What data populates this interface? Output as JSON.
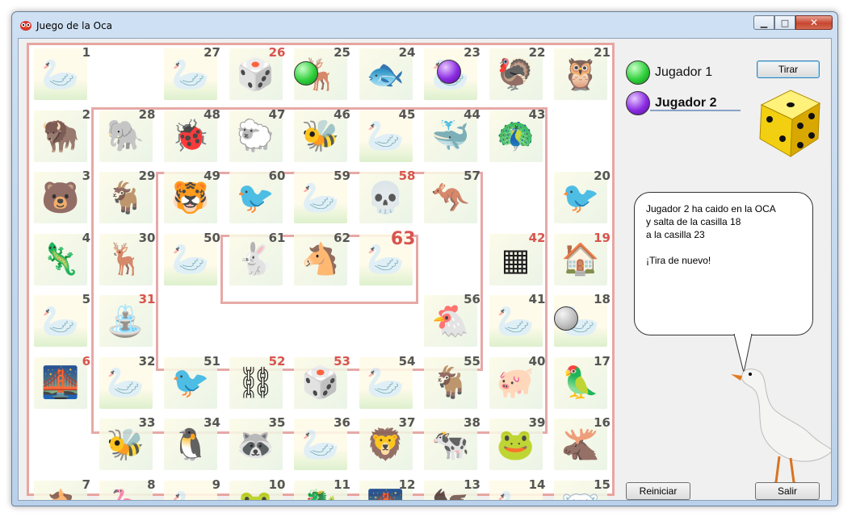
{
  "window": {
    "title": "Juego de la Oca"
  },
  "players": [
    {
      "name": "Jugador 1",
      "color": "#2fcf3a",
      "active": false
    },
    {
      "name": "Jugador 2",
      "color": "#8a2be2",
      "active": true
    }
  ],
  "buttons": {
    "roll": "Tirar",
    "restart": "Reiniciar",
    "exit": "Salir"
  },
  "message": [
    "Jugador 2 ha caido en la OCA",
    "y salta de la casilla 18",
    "a la casilla 23",
    "",
    "¡Tira de nuevo!"
  ],
  "board": {
    "cells": [
      {
        "n": "1",
        "icon": "goose",
        "red": false
      },
      {
        "n": "2",
        "icon": "bison",
        "red": false
      },
      {
        "n": "3",
        "icon": "bear",
        "red": false
      },
      {
        "n": "4",
        "icon": "chameleon",
        "red": false
      },
      {
        "n": "5",
        "icon": "goose",
        "red": false
      },
      {
        "n": "6",
        "icon": "bridge",
        "red": true
      },
      {
        "n": "7",
        "icon": "horse",
        "red": false
      },
      {
        "n": "8",
        "icon": "flamingo",
        "red": false
      },
      {
        "n": "9",
        "icon": "goose",
        "red": false
      },
      {
        "n": "10",
        "icon": "frog",
        "red": false
      },
      {
        "n": "11",
        "icon": "seahorse",
        "red": false
      },
      {
        "n": "12",
        "icon": "bridge",
        "red": false
      },
      {
        "n": "13",
        "icon": "eagle",
        "red": false
      },
      {
        "n": "14",
        "icon": "goose",
        "red": false
      },
      {
        "n": "15",
        "icon": "polar-bear",
        "red": false
      },
      {
        "n": "16",
        "icon": "moose",
        "red": false
      },
      {
        "n": "17",
        "icon": "parrot",
        "red": false
      },
      {
        "n": "18",
        "icon": "goose",
        "red": false
      },
      {
        "n": "19",
        "icon": "inn",
        "red": true
      },
      {
        "n": "20",
        "icon": "ostrich",
        "red": false
      },
      {
        "n": "21",
        "icon": "owl",
        "red": false
      },
      {
        "n": "22",
        "icon": "turkey",
        "red": false
      },
      {
        "n": "23",
        "icon": "goose",
        "red": false
      },
      {
        "n": "24",
        "icon": "fish",
        "red": false
      },
      {
        "n": "25",
        "icon": "deer",
        "red": false
      },
      {
        "n": "26",
        "icon": "dice",
        "red": true
      },
      {
        "n": "27",
        "icon": "goose",
        "red": false
      },
      {
        "n": "28",
        "icon": "elephant",
        "red": false
      },
      {
        "n": "29",
        "icon": "antelope",
        "red": false
      },
      {
        "n": "30",
        "icon": "reindeer",
        "red": false
      },
      {
        "n": "31",
        "icon": "well",
        "red": true
      },
      {
        "n": "32",
        "icon": "goose",
        "red": false
      },
      {
        "n": "33",
        "icon": "insect",
        "red": false
      },
      {
        "n": "34",
        "icon": "penguin",
        "red": false
      },
      {
        "n": "35",
        "icon": "raccoon",
        "red": false
      },
      {
        "n": "36",
        "icon": "goose",
        "red": false
      },
      {
        "n": "37",
        "icon": "lion",
        "red": false
      },
      {
        "n": "38",
        "icon": "cow",
        "red": false
      },
      {
        "n": "39",
        "icon": "frog",
        "red": false
      },
      {
        "n": "40",
        "icon": "pig",
        "red": false
      },
      {
        "n": "41",
        "icon": "goose",
        "red": false
      },
      {
        "n": "42",
        "icon": "maze",
        "red": true
      },
      {
        "n": "43",
        "icon": "peacock",
        "red": false
      },
      {
        "n": "44",
        "icon": "whale",
        "red": false
      },
      {
        "n": "45",
        "icon": "goose",
        "red": false
      },
      {
        "n": "46",
        "icon": "bee",
        "red": false
      },
      {
        "n": "47",
        "icon": "sheep",
        "red": false
      },
      {
        "n": "48",
        "icon": "ladybug",
        "red": false
      },
      {
        "n": "49",
        "icon": "tiger",
        "red": false
      },
      {
        "n": "50",
        "icon": "goose",
        "red": false
      },
      {
        "n": "51",
        "icon": "hummingbird",
        "red": false
      },
      {
        "n": "52",
        "icon": "prisoner",
        "red": true
      },
      {
        "n": "53",
        "icon": "dice",
        "red": true
      },
      {
        "n": "54",
        "icon": "goose",
        "red": false
      },
      {
        "n": "55",
        "icon": "goat",
        "red": false
      },
      {
        "n": "56",
        "icon": "hen",
        "red": false
      },
      {
        "n": "57",
        "icon": "kangaroo",
        "red": false
      },
      {
        "n": "58",
        "icon": "skull",
        "red": true
      },
      {
        "n": "59",
        "icon": "goose",
        "red": false
      },
      {
        "n": "60",
        "icon": "sparrow",
        "red": false
      },
      {
        "n": "61",
        "icon": "rabbit",
        "red": false
      },
      {
        "n": "62",
        "icon": "donkey",
        "red": false
      },
      {
        "n": "63",
        "icon": "goose",
        "red": true
      }
    ]
  }
}
